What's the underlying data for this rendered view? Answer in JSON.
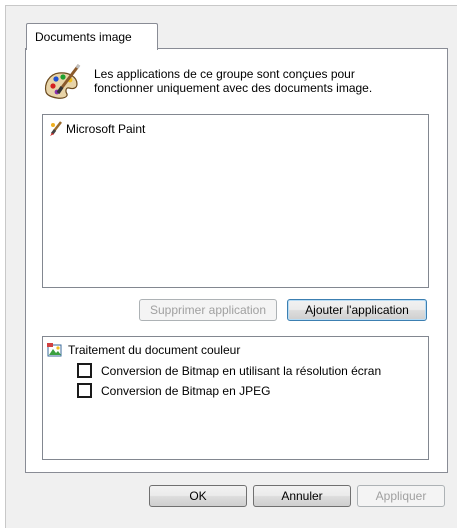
{
  "tab": {
    "label": "Documents image"
  },
  "description": {
    "icon": "paint-palette-icon",
    "line1": "Les applications de ce groupe sont conçues pour",
    "line2": "fonctionner uniquement avec des documents image."
  },
  "applications": [
    {
      "name": "Microsoft Paint",
      "icon": "paintbrush-icon"
    }
  ],
  "app_buttons": {
    "remove_label": "Supprimer application",
    "add_label": "Ajouter l'application"
  },
  "options": {
    "root_label": "Traitement du document couleur",
    "root_icon": "color-document-icon",
    "children": [
      {
        "label": "Conversion de Bitmap en utilisant la résolution écran",
        "checked": false
      },
      {
        "label": "Conversion de Bitmap en JPEG",
        "checked": false
      }
    ]
  },
  "dialog_buttons": {
    "ok_label": "OK",
    "cancel_label": "Annuler",
    "apply_label": "Appliquer"
  }
}
